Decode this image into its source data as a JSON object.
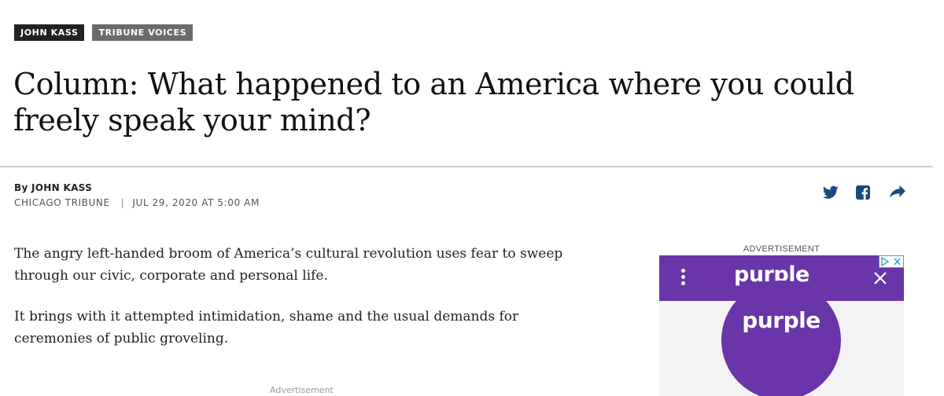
{
  "tags": [
    {
      "label": "JOHN KASS"
    },
    {
      "label": "TRIBUNE VOICES"
    }
  ],
  "headline": "Column: What happened to an America where you could freely speak your mind?",
  "byline": {
    "author": "By JOHN KASS",
    "publication": "CHICAGO TRIBUNE",
    "separator": "|",
    "date": "JUL 29, 2020 AT 5:00 AM"
  },
  "share": {
    "icons": [
      "twitter-icon",
      "facebook-icon",
      "share-arrow-icon"
    ],
    "color": "#1a4a7e"
  },
  "article": {
    "paragraphs": [
      "The angry left-handed broom of America’s cultural revolution uses fear to sweep through our civic, corporate and personal life.",
      "It brings with it attempted intimidation, shame and the usual demands for ceremonies of public groveling."
    ],
    "inline_ad_label": "Advertisement"
  },
  "sidebar_ad": {
    "label": "ADVERTISEMENT",
    "brand": "purple",
    "circle_brand": "purple",
    "brand_color": "#6a35a8"
  }
}
